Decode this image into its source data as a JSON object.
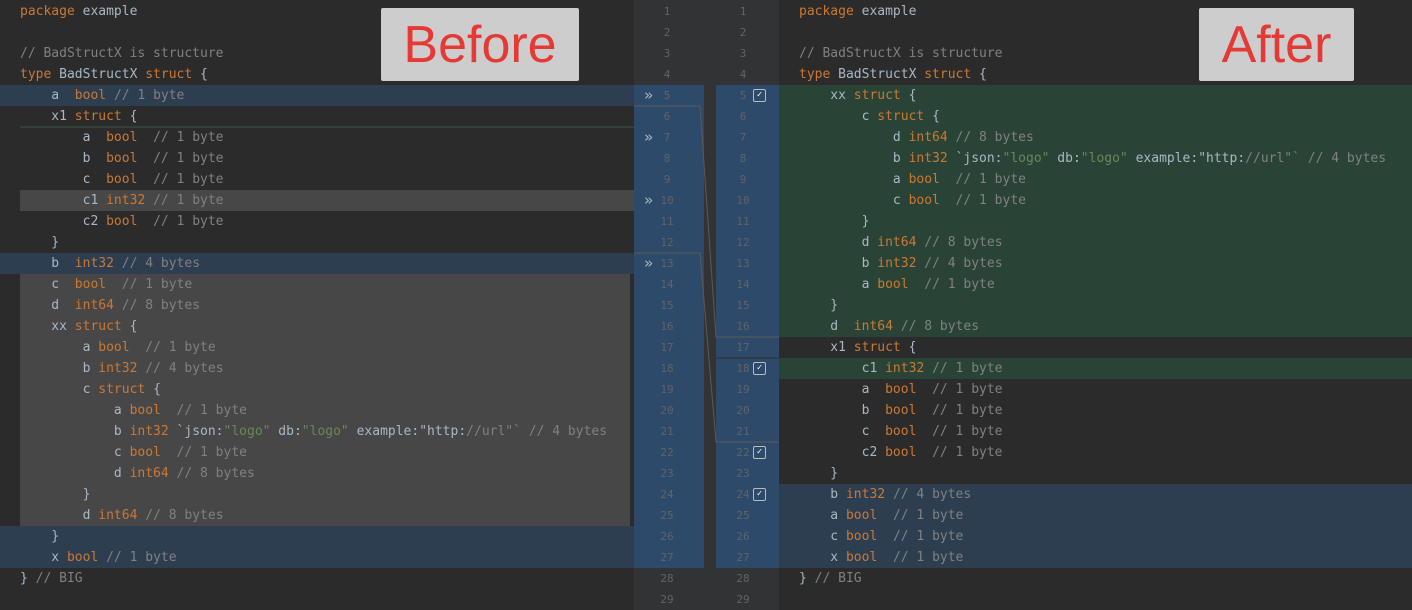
{
  "before_label": "Before",
  "after_label": "After",
  "left": {
    "lines": [
      {
        "t": "package example"
      },
      {
        "t": ""
      },
      {
        "t": "// BadStructX is structure"
      },
      {
        "t": "type BadStructX struct {"
      },
      {
        "t": "    a  bool // 1 byte"
      },
      {
        "t": "    x1 struct {"
      },
      {
        "t": "        a  bool  // 1 byte"
      },
      {
        "t": "        b  bool  // 1 byte"
      },
      {
        "t": "        c  bool  // 1 byte"
      },
      {
        "t": "        c1 int32 // 1 byte"
      },
      {
        "t": "        c2 bool  // 1 byte"
      },
      {
        "t": "    }"
      },
      {
        "t": "    b  int32 // 4 bytes"
      },
      {
        "t": "    c  bool  // 1 byte"
      },
      {
        "t": "    d  int64 // 8 bytes"
      },
      {
        "t": "    xx struct {"
      },
      {
        "t": "        a bool  // 1 byte"
      },
      {
        "t": "        b int32 // 4 bytes"
      },
      {
        "t": "        c struct {"
      },
      {
        "t": "            a bool  // 1 byte"
      },
      {
        "t": "            b int32 `json:\"logo\" db:\"logo\" example:\"http://url\"` // 4 bytes"
      },
      {
        "t": "            c bool  // 1 byte"
      },
      {
        "t": "            d int64 // 8 bytes"
      },
      {
        "t": "        }"
      },
      {
        "t": "        d int64 // 8 bytes"
      },
      {
        "t": "    }"
      },
      {
        "t": "    x bool // 1 byte"
      },
      {
        "t": "} // BIG"
      },
      {
        "t": ""
      }
    ]
  },
  "right": {
    "lines": [
      {
        "t": "package example"
      },
      {
        "t": ""
      },
      {
        "t": "// BadStructX is structure"
      },
      {
        "t": "type BadStructX struct {"
      },
      {
        "t": "    xx struct {"
      },
      {
        "t": "        c struct {"
      },
      {
        "t": "            d int64 // 8 bytes"
      },
      {
        "t": "            b int32 `json:\"logo\" db:\"logo\" example:\"http://url\"` // 4 bytes"
      },
      {
        "t": "            a bool  // 1 byte"
      },
      {
        "t": "            c bool  // 1 byte"
      },
      {
        "t": "        }"
      },
      {
        "t": "        d int64 // 8 bytes"
      },
      {
        "t": "        b int32 // 4 bytes"
      },
      {
        "t": "        a bool  // 1 byte"
      },
      {
        "t": "    }"
      },
      {
        "t": "    d  int64 // 8 bytes"
      },
      {
        "t": "    x1 struct {"
      },
      {
        "t": "        c1 int32 // 1 byte"
      },
      {
        "t": "        a  bool  // 1 byte"
      },
      {
        "t": "        b  bool  // 1 byte"
      },
      {
        "t": "        c  bool  // 1 byte"
      },
      {
        "t": "        c2 bool  // 1 byte"
      },
      {
        "t": "    }"
      },
      {
        "t": "    b int32 // 4 bytes"
      },
      {
        "t": "    a bool  // 1 byte"
      },
      {
        "t": "    c bool  // 1 byte"
      },
      {
        "t": "    x bool  // 1 byte"
      },
      {
        "t": "} // BIG"
      },
      {
        "t": ""
      }
    ]
  },
  "gutter": {
    "left_numbers": [
      "1",
      "2",
      "3",
      "4",
      "5",
      "6",
      "7",
      "8",
      "9",
      "10",
      "11",
      "12",
      "13",
      "14",
      "15",
      "16",
      "17",
      "18",
      "19",
      "20",
      "21",
      "22",
      "23",
      "24",
      "25",
      "26",
      "27",
      "28",
      "29"
    ],
    "right_numbers": [
      "1",
      "2",
      "3",
      "4",
      "5",
      "6",
      "7",
      "8",
      "9",
      "10",
      "11",
      "12",
      "13",
      "14",
      "15",
      "16",
      "17",
      "18",
      "19",
      "20",
      "21",
      "22",
      "23",
      "24",
      "25",
      "26",
      "27",
      "28",
      "29"
    ],
    "apply_icon": "double-chevron-right-icon",
    "accept_icon": "checkbox-icon"
  }
}
